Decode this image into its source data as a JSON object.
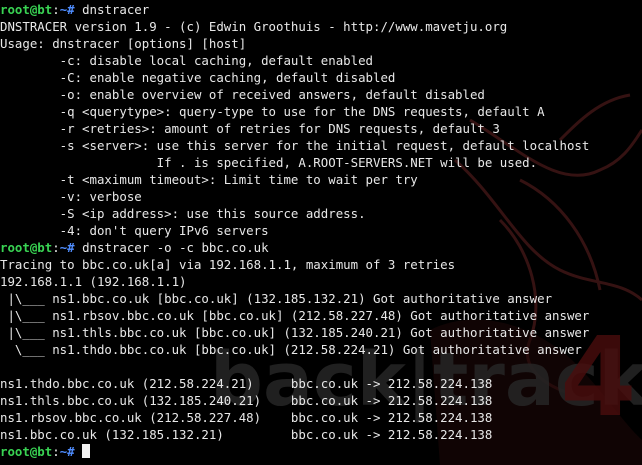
{
  "background": {
    "logo_text": "back|track",
    "version_mark": "4",
    "colors": {
      "base": "#000000",
      "dragon": "#3a1010",
      "logo": "#5a5a5a"
    }
  },
  "prompt": {
    "user": "root@bt",
    "path": "~",
    "symbol": "#"
  },
  "lines": [
    {
      "type": "prompt",
      "command": "dnstracer"
    },
    {
      "type": "output",
      "text": "DNSTRACER version 1.9 - (c) Edwin Groothuis - http://www.mavetju.org"
    },
    {
      "type": "output",
      "text": "Usage: dnstracer [options] [host]"
    },
    {
      "type": "output",
      "text": "        -c: disable local caching, default enabled"
    },
    {
      "type": "output",
      "text": "        -C: enable negative caching, default disabled"
    },
    {
      "type": "output",
      "text": "        -o: enable overview of received answers, default disabled"
    },
    {
      "type": "output",
      "text": "        -q <querytype>: query-type to use for the DNS requests, default A"
    },
    {
      "type": "output",
      "text": "        -r <retries>: amount of retries for DNS requests, default 3"
    },
    {
      "type": "output",
      "text": "        -s <server>: use this server for the initial request, default localhost"
    },
    {
      "type": "output",
      "text": "                     If . is specified, A.ROOT-SERVERS.NET will be used."
    },
    {
      "type": "output",
      "text": "        -t <maximum timeout>: Limit time to wait per try"
    },
    {
      "type": "output",
      "text": "        -v: verbose"
    },
    {
      "type": "output",
      "text": "        -S <ip address>: use this source address."
    },
    {
      "type": "output",
      "text": "        -4: don't query IPv6 servers"
    },
    {
      "type": "prompt",
      "command": "dnstracer -o -c bbc.co.uk"
    },
    {
      "type": "output",
      "text": "Tracing to bbc.co.uk[a] via 192.168.1.1, maximum of 3 retries"
    },
    {
      "type": "output",
      "text": "192.168.1.1 (192.168.1.1)"
    },
    {
      "type": "output",
      "text": " |\\___ ns1.bbc.co.uk [bbc.co.uk] (132.185.132.21) Got authoritative answer"
    },
    {
      "type": "output",
      "text": " |\\___ ns1.rbsov.bbc.co.uk [bbc.co.uk] (212.58.227.48) Got authoritative answer"
    },
    {
      "type": "output",
      "text": " |\\___ ns1.thls.bbc.co.uk [bbc.co.uk] (132.185.240.21) Got authoritative answer"
    },
    {
      "type": "output",
      "text": "  \\___ ns1.thdo.bbc.co.uk [bbc.co.uk] (212.58.224.21) Got authoritative answer"
    },
    {
      "type": "output",
      "text": ""
    },
    {
      "type": "output",
      "text": "ns1.thdo.bbc.co.uk (212.58.224.21)     bbc.co.uk -> 212.58.224.138"
    },
    {
      "type": "output",
      "text": "ns1.thls.bbc.co.uk (132.185.240.21)    bbc.co.uk -> 212.58.224.138"
    },
    {
      "type": "output",
      "text": "ns1.rbsov.bbc.co.uk (212.58.227.48)    bbc.co.uk -> 212.58.224.138"
    },
    {
      "type": "output",
      "text": "ns1.bbc.co.uk (132.185.132.21)         bbc.co.uk -> 212.58.224.138"
    },
    {
      "type": "prompt",
      "command": "",
      "cursor": true
    }
  ]
}
